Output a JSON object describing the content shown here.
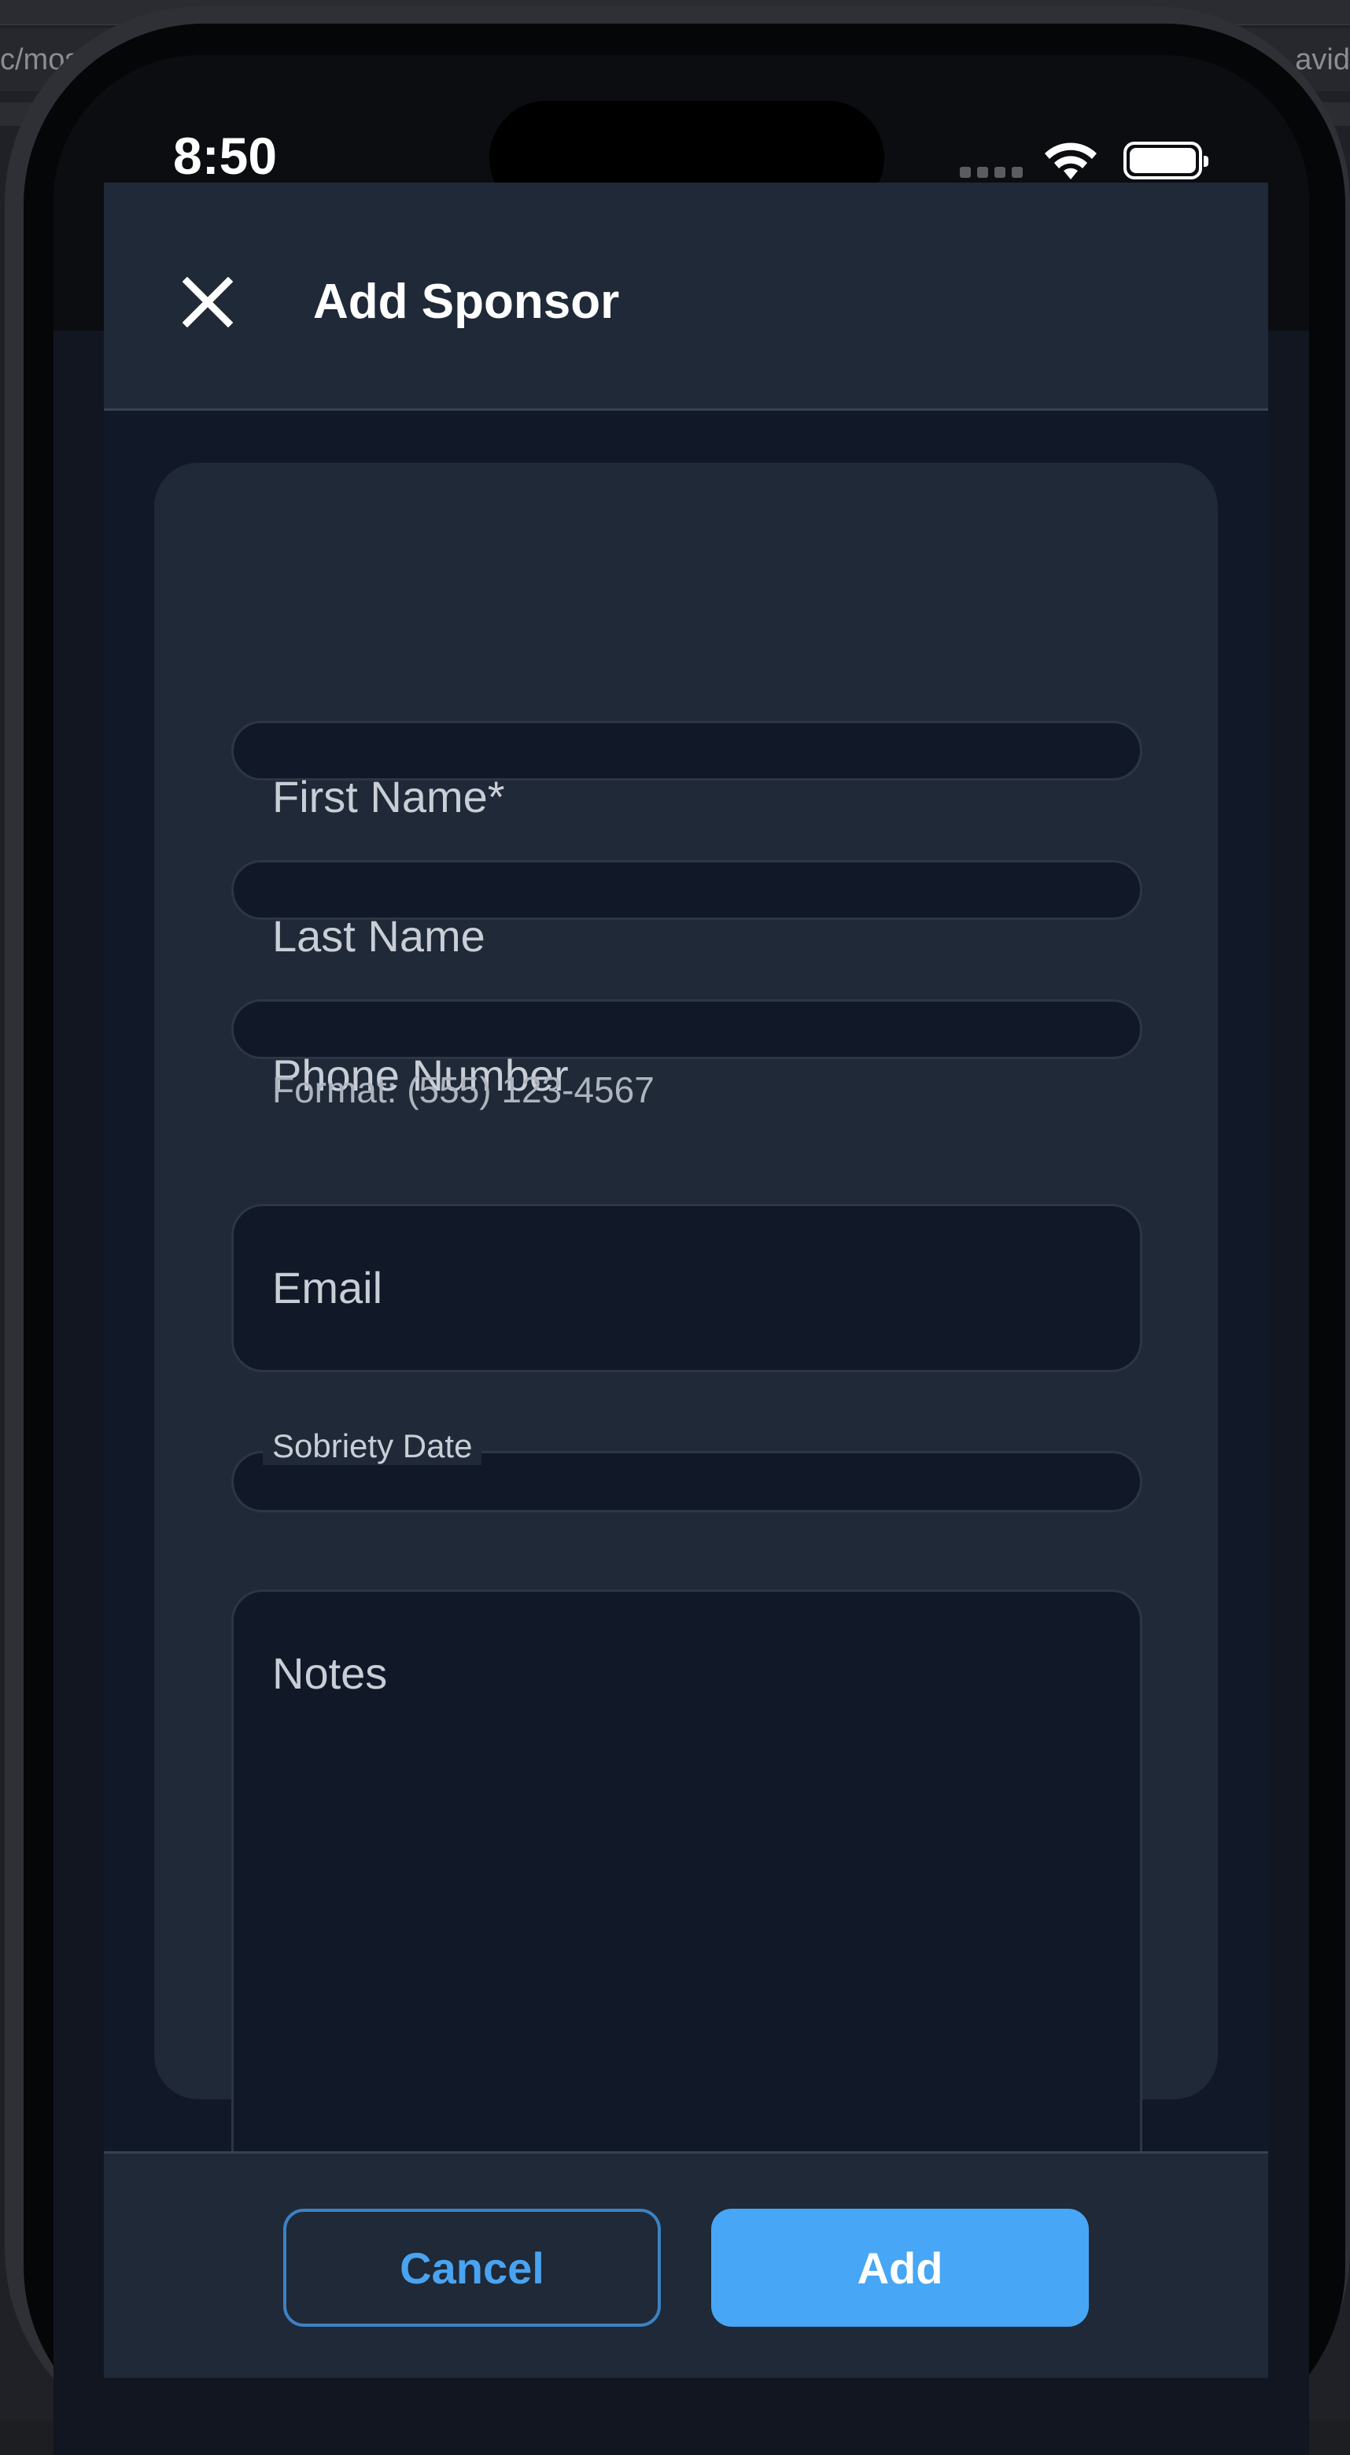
{
  "desktop": {
    "url_left": "c/mos",
    "url_right": "avid"
  },
  "status_bar": {
    "time": "8:50"
  },
  "modal": {
    "title": "Add Sponsor",
    "close_icon": "close-icon"
  },
  "form": {
    "first_name": {
      "label": "First Name*",
      "value": ""
    },
    "last_name": {
      "label": "Last Name",
      "value": ""
    },
    "phone": {
      "label": "Phone Number",
      "helper": "Format: (555) 123-4567",
      "value": ""
    },
    "email": {
      "label": "Email",
      "value": ""
    },
    "sobriety_date": {
      "label": "Sobriety Date",
      "value": ""
    },
    "notes": {
      "label": "Notes",
      "value": ""
    }
  },
  "footer": {
    "cancel_label": "Cancel",
    "add_label": "Add"
  },
  "colors": {
    "accent": "#47a6f5",
    "header_bg": "#1f2937",
    "input_bg": "#111827"
  }
}
